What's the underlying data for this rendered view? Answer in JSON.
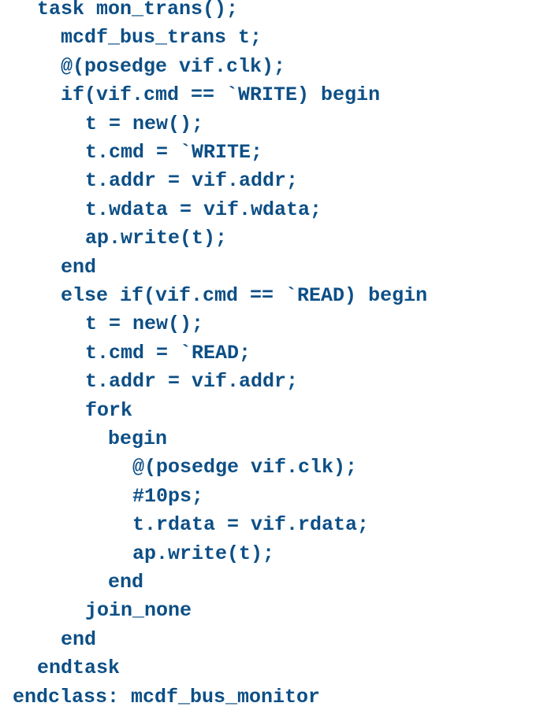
{
  "code": {
    "text_color": "#0d4f86",
    "background_color": "#ffffff",
    "lines": [
      {
        "indent": 1,
        "text": "task mon_trans();"
      },
      {
        "indent": 2,
        "text": "mcdf_bus_trans t;"
      },
      {
        "indent": 2,
        "text": "@(posedge vif.clk);"
      },
      {
        "indent": 2,
        "text": "if(vif.cmd == `WRITE) begin"
      },
      {
        "indent": 3,
        "text": "t = new();"
      },
      {
        "indent": 3,
        "text": "t.cmd = `WRITE;"
      },
      {
        "indent": 3,
        "text": "t.addr = vif.addr;"
      },
      {
        "indent": 3,
        "text": "t.wdata = vif.wdata;"
      },
      {
        "indent": 3,
        "text": "ap.write(t);"
      },
      {
        "indent": 2,
        "text": "end"
      },
      {
        "indent": 2,
        "text": "else if(vif.cmd == `READ) begin"
      },
      {
        "indent": 3,
        "text": "t = new();"
      },
      {
        "indent": 3,
        "text": "t.cmd = `READ;"
      },
      {
        "indent": 3,
        "text": "t.addr = vif.addr;"
      },
      {
        "indent": 3,
        "text": "fork"
      },
      {
        "indent": 4,
        "text": "begin"
      },
      {
        "indent": 5,
        "text": "@(posedge vif.clk);"
      },
      {
        "indent": 5,
        "text": "#10ps;"
      },
      {
        "indent": 5,
        "text": "t.rdata = vif.rdata;"
      },
      {
        "indent": 5,
        "text": "ap.write(t);"
      },
      {
        "indent": 4,
        "text": "end"
      },
      {
        "indent": 3,
        "text": "join_none"
      },
      {
        "indent": 2,
        "text": "end"
      },
      {
        "indent": 1,
        "text": "endtask"
      },
      {
        "indent": 0,
        "text": "endclass: mcdf_bus_monitor"
      }
    ]
  }
}
